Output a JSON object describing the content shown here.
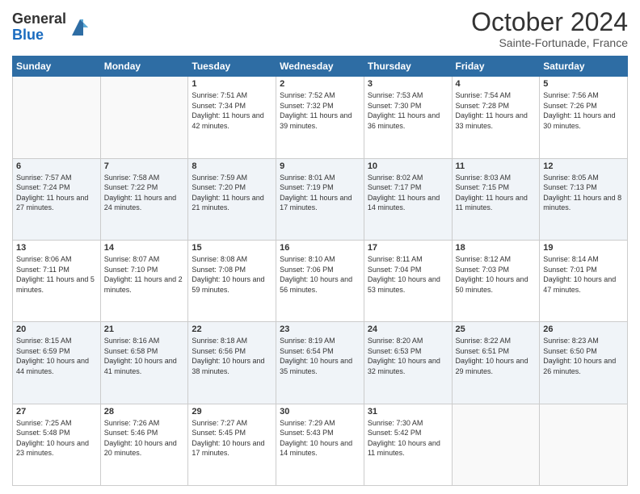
{
  "logo": {
    "general": "General",
    "blue": "Blue"
  },
  "header": {
    "title": "October 2024",
    "subtitle": "Sainte-Fortunade, France"
  },
  "weekdays": [
    "Sunday",
    "Monday",
    "Tuesday",
    "Wednesday",
    "Thursday",
    "Friday",
    "Saturday"
  ],
  "weeks": [
    [
      {
        "day": "",
        "sunrise": "",
        "sunset": "",
        "daylight": ""
      },
      {
        "day": "",
        "sunrise": "",
        "sunset": "",
        "daylight": ""
      },
      {
        "day": "1",
        "sunrise": "Sunrise: 7:51 AM",
        "sunset": "Sunset: 7:34 PM",
        "daylight": "Daylight: 11 hours and 42 minutes."
      },
      {
        "day": "2",
        "sunrise": "Sunrise: 7:52 AM",
        "sunset": "Sunset: 7:32 PM",
        "daylight": "Daylight: 11 hours and 39 minutes."
      },
      {
        "day": "3",
        "sunrise": "Sunrise: 7:53 AM",
        "sunset": "Sunset: 7:30 PM",
        "daylight": "Daylight: 11 hours and 36 minutes."
      },
      {
        "day": "4",
        "sunrise": "Sunrise: 7:54 AM",
        "sunset": "Sunset: 7:28 PM",
        "daylight": "Daylight: 11 hours and 33 minutes."
      },
      {
        "day": "5",
        "sunrise": "Sunrise: 7:56 AM",
        "sunset": "Sunset: 7:26 PM",
        "daylight": "Daylight: 11 hours and 30 minutes."
      }
    ],
    [
      {
        "day": "6",
        "sunrise": "Sunrise: 7:57 AM",
        "sunset": "Sunset: 7:24 PM",
        "daylight": "Daylight: 11 hours and 27 minutes."
      },
      {
        "day": "7",
        "sunrise": "Sunrise: 7:58 AM",
        "sunset": "Sunset: 7:22 PM",
        "daylight": "Daylight: 11 hours and 24 minutes."
      },
      {
        "day": "8",
        "sunrise": "Sunrise: 7:59 AM",
        "sunset": "Sunset: 7:20 PM",
        "daylight": "Daylight: 11 hours and 21 minutes."
      },
      {
        "day": "9",
        "sunrise": "Sunrise: 8:01 AM",
        "sunset": "Sunset: 7:19 PM",
        "daylight": "Daylight: 11 hours and 17 minutes."
      },
      {
        "day": "10",
        "sunrise": "Sunrise: 8:02 AM",
        "sunset": "Sunset: 7:17 PM",
        "daylight": "Daylight: 11 hours and 14 minutes."
      },
      {
        "day": "11",
        "sunrise": "Sunrise: 8:03 AM",
        "sunset": "Sunset: 7:15 PM",
        "daylight": "Daylight: 11 hours and 11 minutes."
      },
      {
        "day": "12",
        "sunrise": "Sunrise: 8:05 AM",
        "sunset": "Sunset: 7:13 PM",
        "daylight": "Daylight: 11 hours and 8 minutes."
      }
    ],
    [
      {
        "day": "13",
        "sunrise": "Sunrise: 8:06 AM",
        "sunset": "Sunset: 7:11 PM",
        "daylight": "Daylight: 11 hours and 5 minutes."
      },
      {
        "day": "14",
        "sunrise": "Sunrise: 8:07 AM",
        "sunset": "Sunset: 7:10 PM",
        "daylight": "Daylight: 11 hours and 2 minutes."
      },
      {
        "day": "15",
        "sunrise": "Sunrise: 8:08 AM",
        "sunset": "Sunset: 7:08 PM",
        "daylight": "Daylight: 10 hours and 59 minutes."
      },
      {
        "day": "16",
        "sunrise": "Sunrise: 8:10 AM",
        "sunset": "Sunset: 7:06 PM",
        "daylight": "Daylight: 10 hours and 56 minutes."
      },
      {
        "day": "17",
        "sunrise": "Sunrise: 8:11 AM",
        "sunset": "Sunset: 7:04 PM",
        "daylight": "Daylight: 10 hours and 53 minutes."
      },
      {
        "day": "18",
        "sunrise": "Sunrise: 8:12 AM",
        "sunset": "Sunset: 7:03 PM",
        "daylight": "Daylight: 10 hours and 50 minutes."
      },
      {
        "day": "19",
        "sunrise": "Sunrise: 8:14 AM",
        "sunset": "Sunset: 7:01 PM",
        "daylight": "Daylight: 10 hours and 47 minutes."
      }
    ],
    [
      {
        "day": "20",
        "sunrise": "Sunrise: 8:15 AM",
        "sunset": "Sunset: 6:59 PM",
        "daylight": "Daylight: 10 hours and 44 minutes."
      },
      {
        "day": "21",
        "sunrise": "Sunrise: 8:16 AM",
        "sunset": "Sunset: 6:58 PM",
        "daylight": "Daylight: 10 hours and 41 minutes."
      },
      {
        "day": "22",
        "sunrise": "Sunrise: 8:18 AM",
        "sunset": "Sunset: 6:56 PM",
        "daylight": "Daylight: 10 hours and 38 minutes."
      },
      {
        "day": "23",
        "sunrise": "Sunrise: 8:19 AM",
        "sunset": "Sunset: 6:54 PM",
        "daylight": "Daylight: 10 hours and 35 minutes."
      },
      {
        "day": "24",
        "sunrise": "Sunrise: 8:20 AM",
        "sunset": "Sunset: 6:53 PM",
        "daylight": "Daylight: 10 hours and 32 minutes."
      },
      {
        "day": "25",
        "sunrise": "Sunrise: 8:22 AM",
        "sunset": "Sunset: 6:51 PM",
        "daylight": "Daylight: 10 hours and 29 minutes."
      },
      {
        "day": "26",
        "sunrise": "Sunrise: 8:23 AM",
        "sunset": "Sunset: 6:50 PM",
        "daylight": "Daylight: 10 hours and 26 minutes."
      }
    ],
    [
      {
        "day": "27",
        "sunrise": "Sunrise: 7:25 AM",
        "sunset": "Sunset: 5:48 PM",
        "daylight": "Daylight: 10 hours and 23 minutes."
      },
      {
        "day": "28",
        "sunrise": "Sunrise: 7:26 AM",
        "sunset": "Sunset: 5:46 PM",
        "daylight": "Daylight: 10 hours and 20 minutes."
      },
      {
        "day": "29",
        "sunrise": "Sunrise: 7:27 AM",
        "sunset": "Sunset: 5:45 PM",
        "daylight": "Daylight: 10 hours and 17 minutes."
      },
      {
        "day": "30",
        "sunrise": "Sunrise: 7:29 AM",
        "sunset": "Sunset: 5:43 PM",
        "daylight": "Daylight: 10 hours and 14 minutes."
      },
      {
        "day": "31",
        "sunrise": "Sunrise: 7:30 AM",
        "sunset": "Sunset: 5:42 PM",
        "daylight": "Daylight: 10 hours and 11 minutes."
      },
      {
        "day": "",
        "sunrise": "",
        "sunset": "",
        "daylight": ""
      },
      {
        "day": "",
        "sunrise": "",
        "sunset": "",
        "daylight": ""
      }
    ]
  ]
}
